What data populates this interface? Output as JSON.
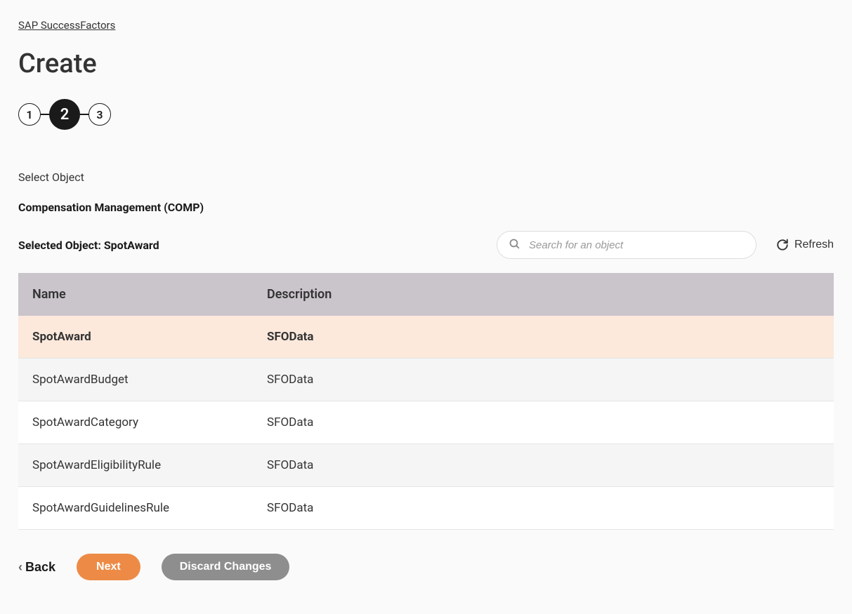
{
  "breadcrumb": "SAP SuccessFactors",
  "page_title": "Create",
  "stepper": {
    "steps": [
      "1",
      "2",
      "3"
    ],
    "active_index": 1
  },
  "section_label": "Select Object",
  "module_label": "Compensation Management (COMP)",
  "selected_object_label": "Selected Object: SpotAward",
  "search": {
    "placeholder": "Search for an object"
  },
  "refresh_label": "Refresh",
  "table": {
    "headers": {
      "name": "Name",
      "description": "Description"
    },
    "rows": [
      {
        "name": "SpotAward",
        "description": "SFOData",
        "selected": true
      },
      {
        "name": "SpotAwardBudget",
        "description": "SFOData",
        "selected": false
      },
      {
        "name": "SpotAwardCategory",
        "description": "SFOData",
        "selected": false
      },
      {
        "name": "SpotAwardEligibilityRule",
        "description": "SFOData",
        "selected": false
      },
      {
        "name": "SpotAwardGuidelinesRule",
        "description": "SFOData",
        "selected": false
      }
    ]
  },
  "footer": {
    "back": "Back",
    "next": "Next",
    "discard": "Discard Changes"
  }
}
